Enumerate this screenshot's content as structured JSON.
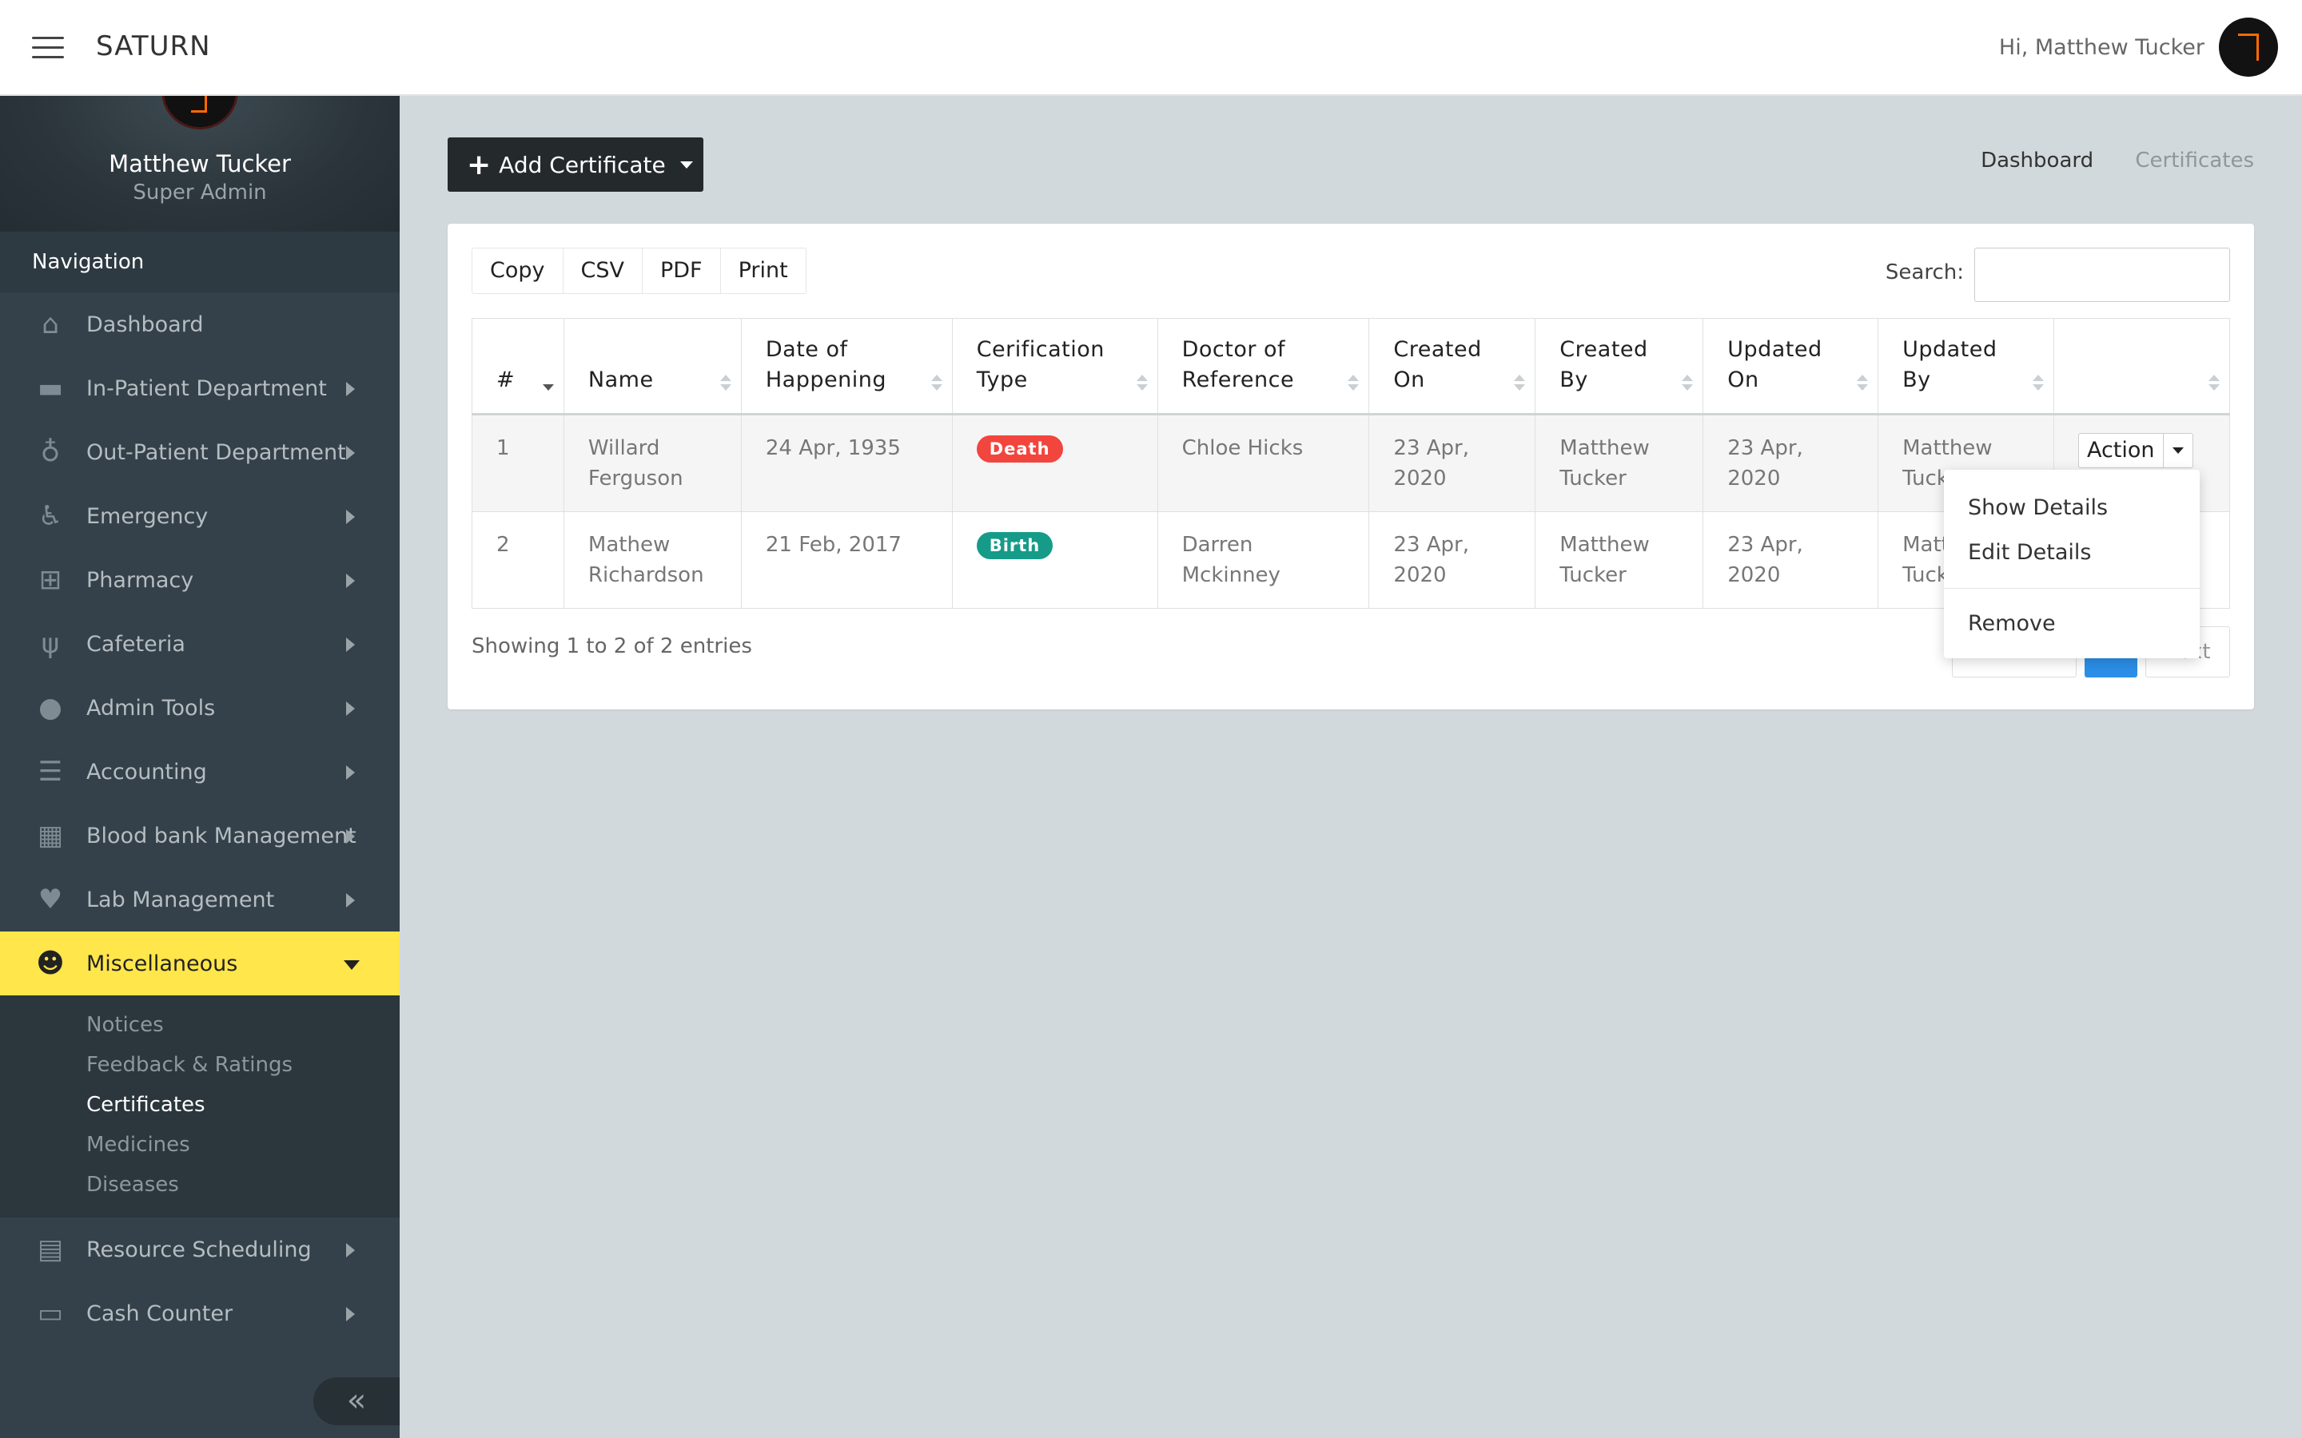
{
  "app": {
    "brand": "SATURN",
    "greeting": "Hi, Matthew Tucker"
  },
  "profile": {
    "name": "Matthew Tucker",
    "role": "Super Admin"
  },
  "sidebar": {
    "heading": "Navigation",
    "items": [
      {
        "label": "Dashboard",
        "icon": "home-icon"
      },
      {
        "label": "In-Patient Department",
        "icon": "bed-icon"
      },
      {
        "label": "Out-Patient Department",
        "icon": "stethoscope-icon"
      },
      {
        "label": "Emergency",
        "icon": "wheelchair-icon"
      },
      {
        "label": "Pharmacy",
        "icon": "medkit-icon"
      },
      {
        "label": "Cafeteria",
        "icon": "utensils-icon"
      },
      {
        "label": "Admin Tools",
        "icon": "user-icon"
      },
      {
        "label": "Accounting",
        "icon": "list-icon"
      },
      {
        "label": "Blood bank Management",
        "icon": "hospital-icon"
      },
      {
        "label": "Lab Management",
        "icon": "heartbeat-icon"
      },
      {
        "label": "Miscellaneous",
        "icon": "user-doctor-icon"
      },
      {
        "label": "Resource Scheduling",
        "icon": "calendar-icon"
      },
      {
        "label": "Cash Counter",
        "icon": "money-icon"
      }
    ],
    "sub_items": [
      "Notices",
      "Feedback & Ratings",
      "Certificates",
      "Medicines",
      "Diseases"
    ],
    "collapse_glyph": "«"
  },
  "toolbar": {
    "add_label": "Add Certificate"
  },
  "breadcrumb": {
    "home": "Dashboard",
    "current": "Certificates"
  },
  "export_buttons": [
    "Copy",
    "CSV",
    "PDF",
    "Print"
  ],
  "search": {
    "label": "Search:",
    "value": ""
  },
  "table": {
    "headers": [
      "#",
      "Name",
      "Date of Happening",
      "Cerification Type",
      "Doctor of Reference",
      "Created On",
      "Created By",
      "Updated On",
      "Updated By",
      ""
    ],
    "rows": [
      {
        "num": "1",
        "name": "Willard Ferguson",
        "date": "24 Apr, 1935",
        "type": "Death",
        "type_color": "#f2453d",
        "doctor": "Chloe Hicks",
        "created_on": "23 Apr, 2020",
        "created_by": "Matthew Tucker",
        "updated_on": "23 Apr, 2020",
        "updated_by": "Matthew Tucker"
      },
      {
        "num": "2",
        "name": "Mathew Richardson",
        "date": "21 Feb, 2017",
        "type": "Birth",
        "type_color": "#169b89",
        "doctor": "Darren Mckinney",
        "created_on": "23 Apr, 2020",
        "created_by": "Matthew Tucker",
        "updated_on": "23 Apr, 2020",
        "updated_by": "Matthew Tucker"
      }
    ],
    "action_label": "Action"
  },
  "info": "Showing 1 to 2 of 2 entries",
  "pager": {
    "next": "Next"
  },
  "dropdown": {
    "show": "Show Details",
    "edit": "Edit Details",
    "remove": "Remove"
  },
  "colors": {
    "accent": "#ffe64a",
    "sidebar": "#34414a",
    "primary": "#2b8fe8"
  }
}
